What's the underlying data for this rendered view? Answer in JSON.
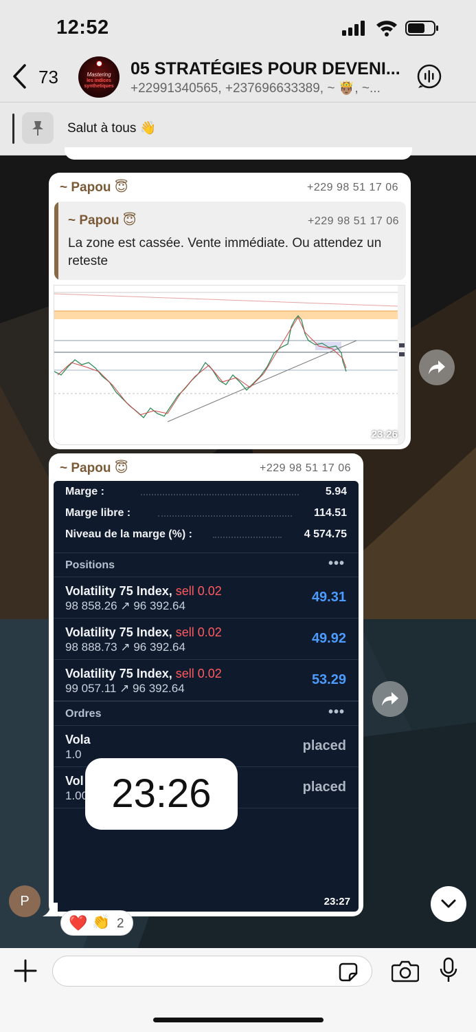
{
  "status_bar": {
    "time": "12:52"
  },
  "header": {
    "back_count": "73",
    "avatar_text": [
      "Mastering",
      "les indices",
      "synthetiques"
    ],
    "title": "05 STRATÉGIES POUR DEVENI...",
    "subtitle": "+22991340565, +237696633389, ~ 🤴🏽, ~..."
  },
  "pinned": {
    "text": "Salut à tous 👋"
  },
  "messages": [
    {
      "sender": "~ Papou",
      "sender_emoji": "😇",
      "phone": "+229 98 51 17 06",
      "quote": {
        "sender": "~ Papou",
        "sender_emoji": "😇",
        "phone": "+229 98 51 17 06",
        "text": "La zone est cassée. Vente immédiate. Ou attendez un reteste"
      },
      "time": "23:26"
    },
    {
      "sender": "~ Papou",
      "sender_emoji": "😇",
      "phone": "+229 98 51 17 06",
      "time": "23:27",
      "trade": {
        "margin_rows": [
          {
            "label": "Marge :",
            "value": "5.94"
          },
          {
            "label": "Marge libre :",
            "value": "114.51"
          },
          {
            "label": "Niveau de la marge (%) :",
            "value": "4 574.75"
          }
        ],
        "positions_label": "Positions",
        "more": "•••",
        "positions": [
          {
            "name": "Volatility 75 Index,",
            "side": "sell 0.02",
            "prices": "98 858.26 ↗ 96 392.64",
            "profit": "49.31"
          },
          {
            "name": "Volatility 75 Index,",
            "side": "sell 0.02",
            "prices": "98 888.73 ↗ 96 392.64",
            "profit": "49.92"
          },
          {
            "name": "Volatility 75 Index,",
            "side": "sell 0.02",
            "prices": "99 057.11 ↗ 96 392.64",
            "profit": "53.29"
          }
        ],
        "orders_label": "Ordres",
        "orders": [
          {
            "name": "Vola",
            "sub": "1.0",
            "status": "placed"
          },
          {
            "name": "Vol",
            "sub": "1.00",
            "status": "placed"
          }
        ],
        "overlay_time": "23:26"
      },
      "reactions": {
        "emojis": [
          "❤️",
          "👏"
        ],
        "count": "2"
      }
    }
  ],
  "sender_avatar_letter": "P",
  "colors": {
    "sender": "#7a5a36",
    "profit": "#4c9cff",
    "sell": "#ff5a5f",
    "panel": "#0f1a2c"
  }
}
